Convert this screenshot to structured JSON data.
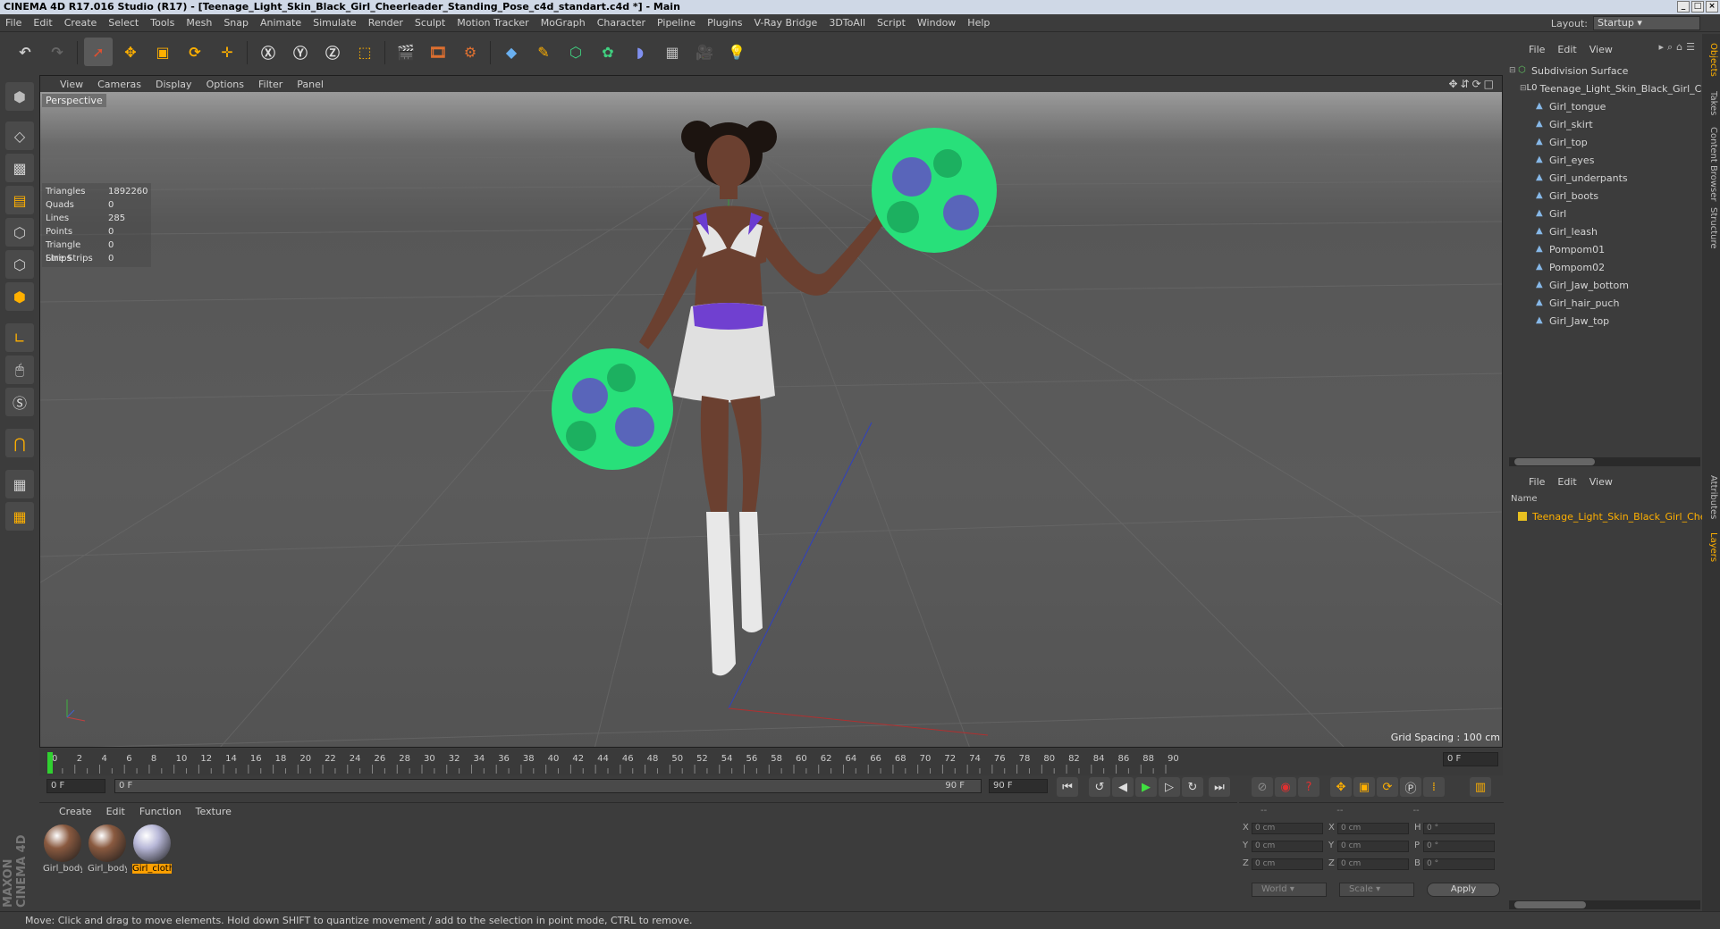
{
  "window": {
    "title": "CINEMA 4D R17.016 Studio (R17) - [Teenage_Light_Skin_Black_Girl_Cheerleader_Standing_Pose_c4d_standart.c4d *] - Main"
  },
  "menubar": [
    "File",
    "Edit",
    "Create",
    "Select",
    "Tools",
    "Mesh",
    "Snap",
    "Animate",
    "Simulate",
    "Render",
    "Sculpt",
    "Motion Tracker",
    "MoGraph",
    "Character",
    "Pipeline",
    "Plugins",
    "V-Ray Bridge",
    "3DToAll",
    "Script",
    "Window",
    "Help"
  ],
  "layout": {
    "label": "Layout:",
    "value": "Startup"
  },
  "viewport": {
    "menu": [
      "View",
      "Cameras",
      "Display",
      "Options",
      "Filter",
      "Panel"
    ],
    "camera": "Perspective",
    "stats": [
      {
        "k": "Triangles",
        "v": "1892260"
      },
      {
        "k": "Quads",
        "v": "0"
      },
      {
        "k": "Lines",
        "v": "285"
      },
      {
        "k": "Points",
        "v": "0"
      },
      {
        "k": "Triangle Strips",
        "v": "0"
      },
      {
        "k": "Line Strips",
        "v": "0"
      }
    ],
    "grid_spacing": "Grid Spacing : 100 cm"
  },
  "timeline": {
    "ticks": [
      "0",
      "2",
      "4",
      "6",
      "8",
      "10",
      "12",
      "14",
      "16",
      "18",
      "20",
      "22",
      "24",
      "26",
      "28",
      "30",
      "32",
      "34",
      "36",
      "38",
      "40",
      "42",
      "44",
      "46",
      "48",
      "50",
      "52",
      "54",
      "56",
      "58",
      "60",
      "62",
      "64",
      "66",
      "68",
      "70",
      "72",
      "74",
      "76",
      "78",
      "80",
      "82",
      "84",
      "86",
      "88",
      "90"
    ],
    "current_frame": "0 F"
  },
  "playbar": {
    "start": "0 F",
    "range_start": "0 F",
    "range_end": "90 F",
    "end": "90 F"
  },
  "materials": {
    "menu": [
      "Create",
      "Edit",
      "Function",
      "Texture"
    ],
    "items": [
      {
        "label": "Girl_body",
        "color": "#8a5a40"
      },
      {
        "label": "Girl_body",
        "color": "#8a5a40"
      },
      {
        "label": "Girl_cloth",
        "color": "#b8b8d8"
      }
    ]
  },
  "coords": {
    "headers": [
      "--",
      "--",
      "--"
    ],
    "rows": [
      {
        "a": "X",
        "v1": "0 cm",
        "b": "X",
        "v2": "0 cm",
        "c": "H",
        "v3": "0 °"
      },
      {
        "a": "Y",
        "v1": "0 cm",
        "b": "Y",
        "v2": "0 cm",
        "c": "P",
        "v3": "0 °"
      },
      {
        "a": "Z",
        "v1": "0 cm",
        "b": "Z",
        "v2": "0 cm",
        "c": "B",
        "v3": "0 °"
      }
    ],
    "mode": "World",
    "scale": "Scale",
    "apply": "Apply"
  },
  "objects": {
    "menu": [
      "File",
      "Edit",
      "View"
    ],
    "root": "Subdivision Surface",
    "group": "Teenage_Light_Skin_Black_Girl_Che",
    "children": [
      "Girl_tongue",
      "Girl_skirt",
      "Girl_top",
      "Girl_eyes",
      "Girl_underpants",
      "Girl_boots",
      "Girl",
      "Girl_leash",
      "Pompom01",
      "Pompom02",
      "Girl_Jaw_bottom",
      "Girl_hair_puch",
      "Girl_Jaw_top"
    ]
  },
  "layers": {
    "menu": [
      "File",
      "Edit",
      "View"
    ],
    "name_header": "Name",
    "item": "Teenage_Light_Skin_Black_Girl_Che"
  },
  "side_tabs": [
    "Objects",
    "Takes",
    "Content Browser",
    "Structure",
    "Attributes",
    "Layers"
  ],
  "status": "Move: Click and drag to move elements. Hold down SHIFT to quantize movement / add to the selection in point mode, CTRL to remove.",
  "branding": "MAXON CINEMA 4D"
}
